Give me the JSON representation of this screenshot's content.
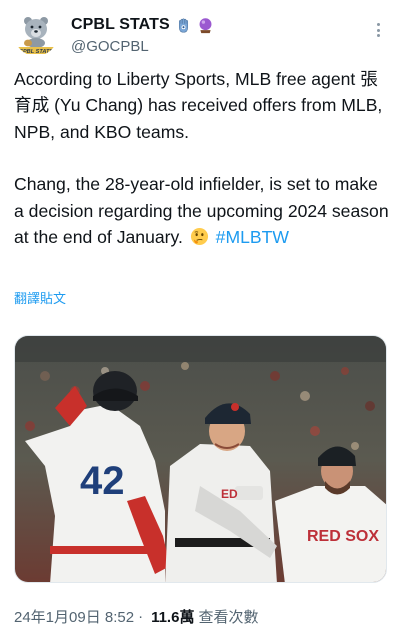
{
  "account": {
    "display_name": "CPBL STATS",
    "handle": "@GOCPBL",
    "avatar_text": "CPBL STATS"
  },
  "tweet": {
    "paragraph1": "According to Liberty Sports, MLB free agent 張育成 (Yu Chang) has received offers from MLB, NPB, and KBO teams.",
    "paragraph2": "Chang, the 28-year-old infielder, is set to make a decision regarding the upcoming 2024 season at the end of January.",
    "hashtag": "#MLBTW",
    "translate_label": "翻譯貼文"
  },
  "media": {
    "jersey_number": "42",
    "jersey_text": "RED SOX"
  },
  "meta": {
    "time_text": "24年1月09日 8:52",
    "separator": "·",
    "views_count": "11.6萬",
    "views_label": "查看次數"
  },
  "colors": {
    "accent": "#1d9bf0",
    "secondary_text": "#536471",
    "primary_text": "#0f1419",
    "red_sox_red": "#bd3039",
    "navy": "#0c2340"
  },
  "icons": [
    "bear-logo-icon",
    "hamsa-badge-icon",
    "crystal-ball-badge-icon",
    "more-options-icon",
    "thinking-face-emoji-icon"
  ]
}
